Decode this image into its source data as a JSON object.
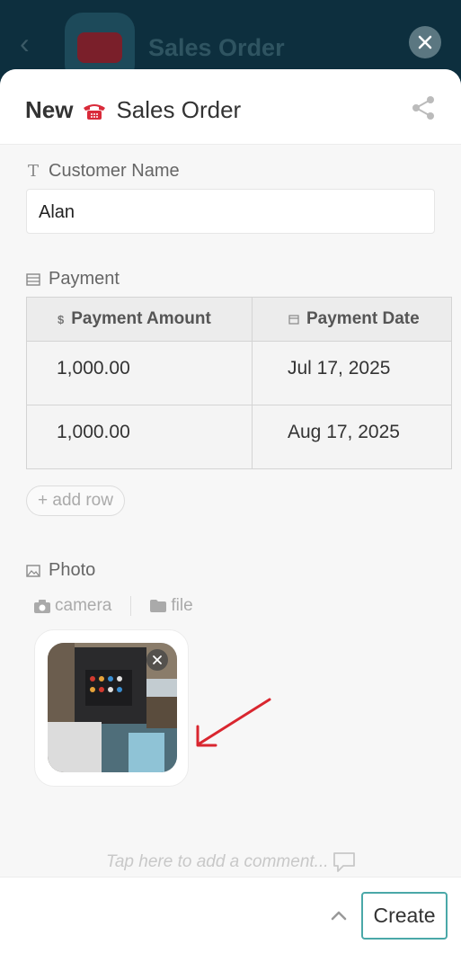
{
  "background": {
    "title": "Sales Order"
  },
  "sheet": {
    "title_prefix": "New",
    "title_name": "Sales Order",
    "icons": {
      "app": "telephone-icon",
      "share": "share-icon",
      "close": "close-icon"
    }
  },
  "customer": {
    "label": "Customer Name",
    "value": "Alan",
    "icon": "text-type-icon"
  },
  "payment": {
    "label": "Payment",
    "icon": "table-icon",
    "columns": [
      {
        "label": "Payment Amount",
        "icon": "dollar-icon"
      },
      {
        "label": "Payment Date",
        "icon": "calendar-icon"
      }
    ],
    "rows": [
      {
        "amount": "1,000.00",
        "date": "Jul 17, 2025"
      },
      {
        "amount": "1,000.00",
        "date": "Aug 17, 2025"
      }
    ],
    "add_row_label": "+ add row"
  },
  "photo": {
    "label": "Photo",
    "icon": "image-icon",
    "camera_label": "camera",
    "file_label": "file"
  },
  "comment": {
    "placeholder": "Tap here to add a comment..."
  },
  "footer": {
    "create_label": "Create"
  },
  "colors": {
    "accent": "#4aa8a8",
    "overlay": "#0d2f3e",
    "annotation_arrow": "#d9262f"
  }
}
